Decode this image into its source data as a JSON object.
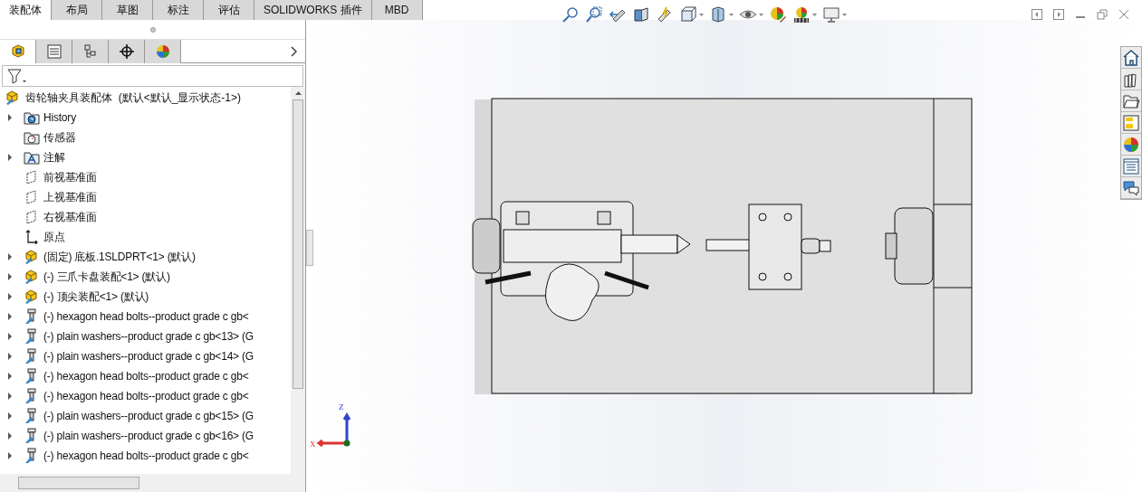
{
  "tabs": [
    {
      "label": "装配体",
      "selected": true
    },
    {
      "label": "布局",
      "selected": false
    },
    {
      "label": "草图",
      "selected": false
    },
    {
      "label": "标注",
      "selected": false
    },
    {
      "label": "评估",
      "selected": false
    },
    {
      "label": "SOLIDWORKS 插件",
      "selected": false
    },
    {
      "label": "MBD",
      "selected": false
    }
  ],
  "panel_tabs": [
    {
      "kind": "feature",
      "selected": true
    },
    {
      "kind": "property",
      "selected": false
    },
    {
      "kind": "config",
      "selected": false
    },
    {
      "kind": "dim",
      "selected": false
    },
    {
      "kind": "display",
      "selected": false
    }
  ],
  "tree": {
    "root": "齿轮轴夹具装配体  (默认<默认_显示状态-1>)",
    "items": [
      {
        "kind": "history",
        "label": "History",
        "expandable": true
      },
      {
        "kind": "sensor",
        "label": "传感器",
        "expandable": false
      },
      {
        "kind": "annotation",
        "label": "注解",
        "expandable": true
      },
      {
        "kind": "plane",
        "label": "前视基准面",
        "expandable": false
      },
      {
        "kind": "plane",
        "label": "上视基准面",
        "expandable": false
      },
      {
        "kind": "plane",
        "label": "右视基准面",
        "expandable": false
      },
      {
        "kind": "origin",
        "label": "原点",
        "expandable": false
      },
      {
        "kind": "part",
        "label": "(固定) 底板.1SLDPRT<1> (默认)",
        "expandable": true
      },
      {
        "kind": "part",
        "label": "(-) 三爪卡盘装配<1> (默认)",
        "expandable": true
      },
      {
        "kind": "part",
        "label": "(-) 顶尖装配<1> (默认)",
        "expandable": true
      },
      {
        "kind": "fastener",
        "label": "(-) hexagon head bolts--product grade c gb<",
        "expandable": true
      },
      {
        "kind": "fastener",
        "label": "(-) plain washers--product grade c gb<13> (G",
        "expandable": true
      },
      {
        "kind": "fastener",
        "label": "(-) plain washers--product grade c gb<14> (G",
        "expandable": true
      },
      {
        "kind": "fastener",
        "label": "(-) hexagon head bolts--product grade c gb<",
        "expandable": true
      },
      {
        "kind": "fastener",
        "label": "(-) hexagon head bolts--product grade c gb<",
        "expandable": true
      },
      {
        "kind": "fastener",
        "label": "(-) plain washers--product grade c gb<15> (G",
        "expandable": true
      },
      {
        "kind": "fastener",
        "label": "(-) plain washers--product grade c gb<16> (G",
        "expandable": true
      },
      {
        "kind": "fastener",
        "label": "(-) hexagon head bolts--product grade c gb<",
        "expandable": true
      }
    ]
  },
  "triad": {
    "x_label": "X",
    "z_label": "Z"
  }
}
